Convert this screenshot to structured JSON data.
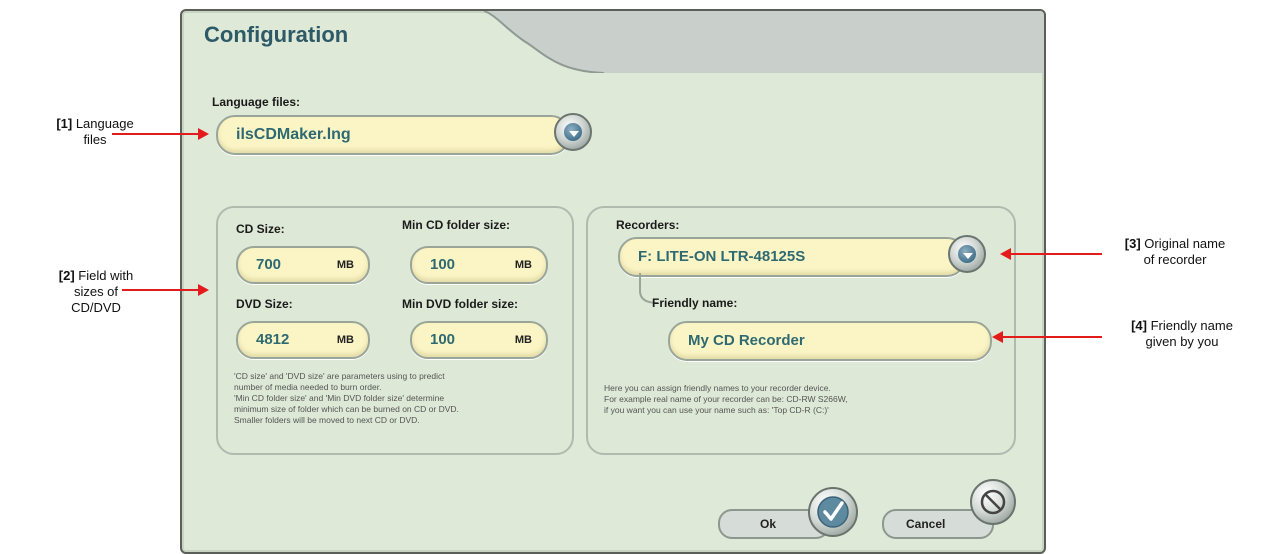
{
  "dialog": {
    "title": "Configuration",
    "language": {
      "label": "Language files:",
      "value": "ilsCDMaker.lng"
    },
    "sizes": {
      "cd_size_label": "CD Size:",
      "cd_size_value": "700",
      "cd_size_unit": "MB",
      "min_cd_label": "Min CD folder size:",
      "min_cd_value": "100",
      "min_cd_unit": "MB",
      "dvd_size_label": "DVD Size:",
      "dvd_size_value": "4812",
      "dvd_size_unit": "MB",
      "min_dvd_label": "Min DVD folder size:",
      "min_dvd_value": "100",
      "min_dvd_unit": "MB",
      "note_lines": [
        "'CD size' and 'DVD size' are parameters using to predict",
        "number of media needed to burn order.",
        "'Min CD folder size' and 'Min DVD folder size' determine",
        "minimum size of folder which can be burned on CD or DVD.",
        "Smaller folders will be moved to next CD or DVD."
      ]
    },
    "recorders": {
      "label": "Recorders:",
      "value": "F: LITE-ON  LTR-48125S",
      "friendly_label": "Friendly name:",
      "friendly_value": "My CD Recorder",
      "note_lines": [
        "Here you can assign friendly names to your recorder device.",
        "For example real name of your recorder can be: CD-RW S266W,",
        "if you want you can use your name such as: 'Top CD-R (C:)'"
      ]
    },
    "buttons": {
      "ok_label": "Ok",
      "cancel_label": "Cancel"
    }
  },
  "annotations": {
    "a1": {
      "tag": "[1]",
      "line1": " Language",
      "line2": "files"
    },
    "a2": {
      "tag": "[2]",
      "line1": " Field with",
      "line2": "sizes of",
      "line3": "CD/DVD"
    },
    "a3": {
      "tag": "[3]",
      "line1": " Original name",
      "line2": "of recorder"
    },
    "a4": {
      "tag": "[4]",
      "line1": " Friendly name",
      "line2": "given by you"
    }
  },
  "colors": {
    "accent_title": "#2e5a67",
    "field_bg": "#fbf5c6",
    "dialog_bg": "#dfe9d8",
    "arrow": "#e31b1b"
  },
  "icons": {
    "dropdown": "chevron-down-icon",
    "ok": "check-icon",
    "cancel": "no-entry-icon"
  }
}
